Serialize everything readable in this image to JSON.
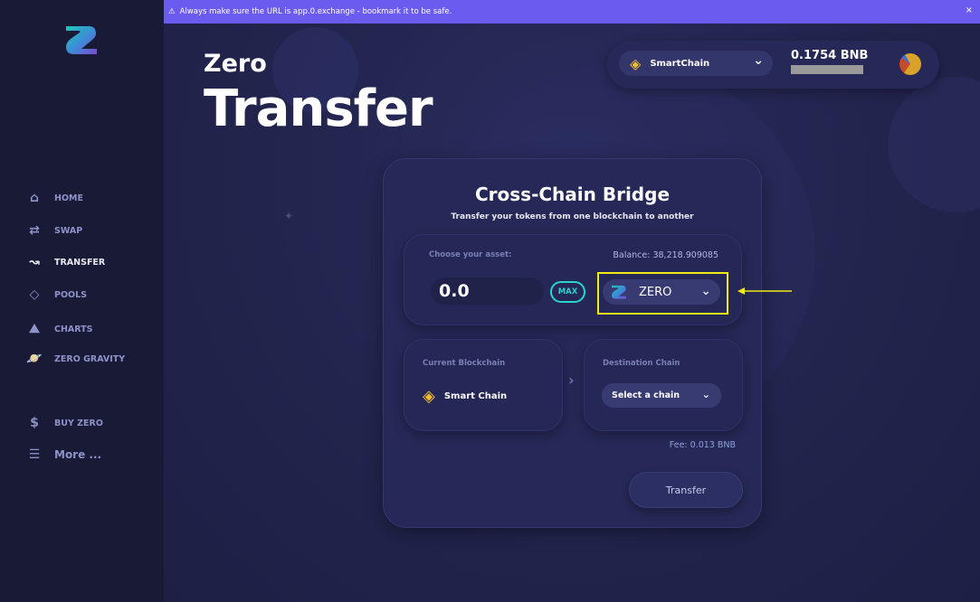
{
  "banner": {
    "text": "Always make sure the URL is app.0.exchange - bookmark it to be safe.",
    "close": "×"
  },
  "sidebar": {
    "items": [
      {
        "label": "HOME",
        "icon": "home-icon"
      },
      {
        "label": "SWAP",
        "icon": "swap-icon"
      },
      {
        "label": "TRANSFER",
        "icon": "transfer-icon",
        "active": true
      },
      {
        "label": "POOLS",
        "icon": "diamond-icon"
      },
      {
        "label": "CHARTS",
        "icon": "chart-icon"
      },
      {
        "label": "ZERO GRAVITY",
        "icon": "planet-icon"
      },
      {
        "label": "BUY ZERO",
        "icon": "dollar-icon"
      },
      {
        "label": "More ...",
        "icon": "menu-icon"
      }
    ]
  },
  "header": {
    "line1": "Zero",
    "line2": "Transfer"
  },
  "wallet": {
    "chain": "SmartChain",
    "balance": "0.1754 BNB"
  },
  "card": {
    "title": "Cross-Chain Bridge",
    "subtitle": "Transfer your tokens from one blockchain to another",
    "asset_label": "Choose your asset:",
    "balance": "Balance: 38,218.909085",
    "amount": "0.0",
    "max": "MAX",
    "token": "ZERO",
    "current_label": "Current Blockchain",
    "current_chain": "Smart Chain",
    "dest_label": "Destination Chain",
    "dest_placeholder": "Select a chain",
    "fee": "Fee: 0.013 BNB",
    "transfer": "Transfer"
  },
  "colors": {
    "banner": "#6b5cf0",
    "accent": "#2ad4c8",
    "highlight": "#f1eb16",
    "bnb": "#f3ba2f"
  }
}
